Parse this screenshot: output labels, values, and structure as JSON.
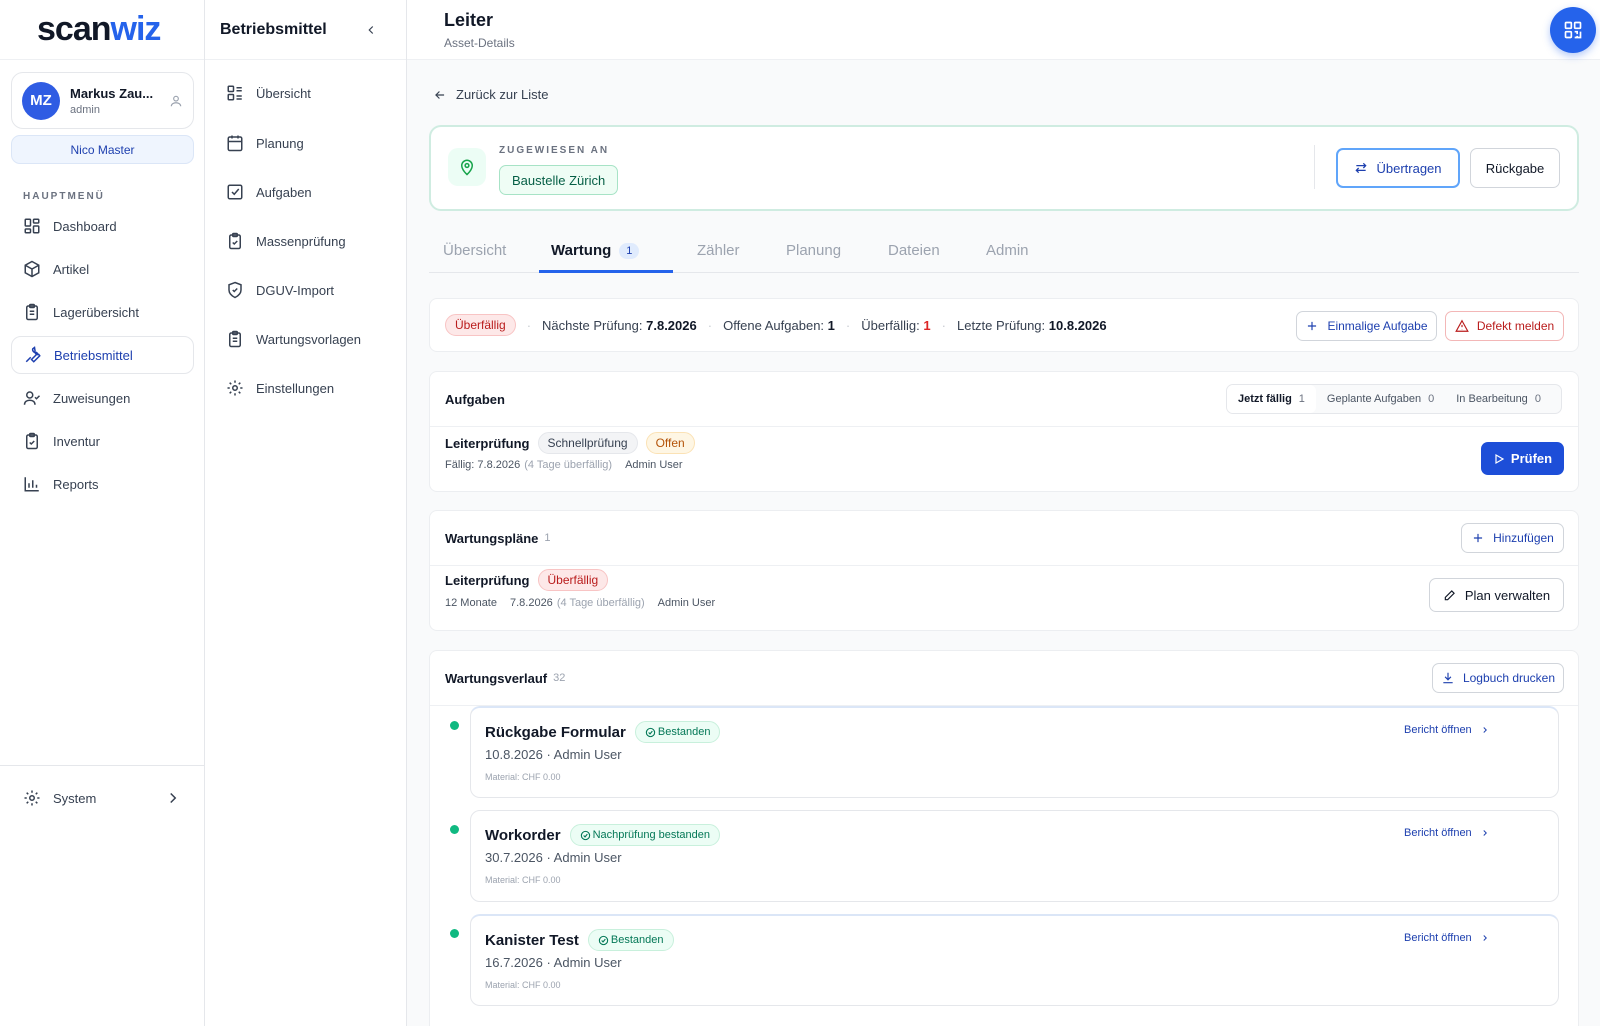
{
  "app": {
    "logo_a": "scan",
    "logo_b": "wiz"
  },
  "user": {
    "initials": "MZ",
    "name": "Markus Zau...",
    "role": "admin",
    "tenant": "Nico Master"
  },
  "sidebar": {
    "section_label": "HAUPTMENÜ",
    "items": [
      {
        "label": "Dashboard",
        "icon": "dashboard-icon"
      },
      {
        "label": "Artikel",
        "icon": "box-icon"
      },
      {
        "label": "Lagerübersicht",
        "icon": "clipboard-icon"
      },
      {
        "label": "Betriebsmittel",
        "icon": "wrench-icon",
        "active": true
      },
      {
        "label": "Zuweisungen",
        "icon": "user-check-icon"
      },
      {
        "label": "Inventur",
        "icon": "clipboard-check-icon"
      },
      {
        "label": "Reports",
        "icon": "bar-chart-icon"
      }
    ],
    "system_label": "System"
  },
  "subnav": {
    "title": "Betriebsmittel",
    "items": [
      {
        "label": "Übersicht",
        "icon": "list-icon"
      },
      {
        "label": "Planung",
        "icon": "calendar-icon"
      },
      {
        "label": "Aufgaben",
        "icon": "checkbox-icon"
      },
      {
        "label": "Massenprüfung",
        "icon": "clipboard-check-icon"
      },
      {
        "label": "DGUV-Import",
        "icon": "shield-check-icon"
      },
      {
        "label": "Wartungsvorlagen",
        "icon": "clipboard-list-icon"
      },
      {
        "label": "Einstellungen",
        "icon": "gear-icon"
      }
    ]
  },
  "header": {
    "title": "Leiter",
    "subtitle": "Asset-Details"
  },
  "back_label": "Zurück zur Liste",
  "assignment": {
    "label": "ZUGEWIESEN AN",
    "location": "Baustelle Zürich",
    "transfer_label": "Übertragen",
    "return_label": "Rückgabe"
  },
  "tabs": [
    {
      "label": "Übersicht"
    },
    {
      "label": "Wartung",
      "count": "1",
      "active": true
    },
    {
      "label": "Zähler"
    },
    {
      "label": "Planung"
    },
    {
      "label": "Dateien"
    },
    {
      "label": "Admin"
    }
  ],
  "status": {
    "badge": "Überfällig",
    "next_label": "Nächste Prüfung:",
    "next_value": "7.8.2026",
    "open_label": "Offene Aufgaben:",
    "open_value": "1",
    "overdue_label": "Überfällig:",
    "overdue_value": "1",
    "last_label": "Letzte Prüfung:",
    "last_value": "10.8.2026",
    "once_label": "Einmalige Aufgabe",
    "defect_label": "Defekt melden"
  },
  "tasks": {
    "title": "Aufgaben",
    "segments": [
      {
        "label": "Jetzt fällig",
        "count": "1"
      },
      {
        "label": "Geplante Aufgaben",
        "count": "0"
      },
      {
        "label": "In Bearbeitung",
        "count": "0"
      }
    ],
    "item": {
      "name": "Leiterprüfung",
      "type": "Schnellprüfung",
      "state": "Offen",
      "due": "Fällig: 7.8.2026",
      "due_note": "(4 Tage überfällig)",
      "assignee": "Admin User",
      "action": "Prüfen"
    }
  },
  "plans": {
    "title": "Wartungspläne",
    "count": "1",
    "add_label": "Hinzufügen",
    "item": {
      "name": "Leiterprüfung",
      "state": "Überfällig",
      "interval": "12 Monate",
      "date": "7.8.2026",
      "note": "(4 Tage überfällig)",
      "assignee": "Admin User",
      "manage_label": "Plan verwalten"
    }
  },
  "history": {
    "title": "Wartungsverlauf",
    "count": "32",
    "print_label": "Logbuch drucken",
    "items": [
      {
        "title": "Rückgabe Formular",
        "status": "Bestanden",
        "sub": "10.8.2026 · Admin User",
        "material": "Material: CHF 0.00",
        "link": "Bericht öffnen"
      },
      {
        "title": "Workorder",
        "status": "Nachprüfung bestanden",
        "sub": "30.7.2026 · Admin User",
        "material": "Material: CHF 0.00",
        "link": "Bericht öffnen"
      },
      {
        "title": "Kanister Test",
        "status": "Bestanden",
        "sub": "16.7.2026 · Admin User",
        "material": "Material: CHF 0.00",
        "link": "Bericht öffnen"
      }
    ]
  }
}
